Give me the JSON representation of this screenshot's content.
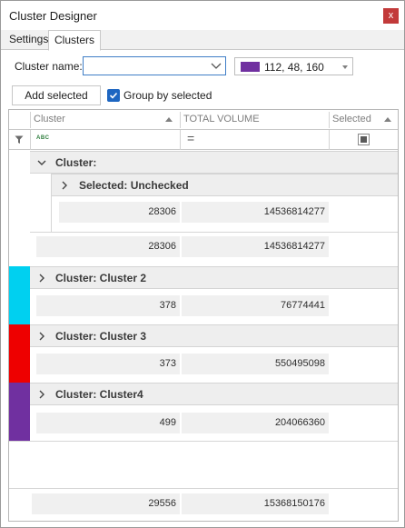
{
  "window": {
    "title": "Cluster Designer",
    "close_glyph": "x"
  },
  "tabs": [
    {
      "label": "Settings"
    },
    {
      "label": "Clusters",
      "active": true
    }
  ],
  "form": {
    "cluster_name_label": "Cluster name:",
    "cluster_name_value": "",
    "color_text": "112, 48, 160",
    "color_hex": "#7030a0",
    "add_selected_label": "Add selected",
    "group_by_label": "Group by selected",
    "group_by_checked": true
  },
  "grid": {
    "columns": [
      {
        "label": "Cluster"
      },
      {
        "label": "TOTAL VOLUME"
      },
      {
        "label": "Selected"
      }
    ],
    "filter_text_glyph": "ABC",
    "filter_number_glyph": "=",
    "groups": [
      {
        "label": "Cluster:",
        "color": "",
        "subgroup": {
          "label": "Selected: Unchecked",
          "count": "28306",
          "volume": "14536814277"
        },
        "count": "28306",
        "volume": "14536814277"
      },
      {
        "label": "Cluster: Cluster 2",
        "color": "#00d0f0",
        "count": "378",
        "volume": "76774441"
      },
      {
        "label": "Cluster: Cluster 3",
        "color": "#ee0000",
        "count": "373",
        "volume": "550495098"
      },
      {
        "label": "Cluster: Cluster4",
        "color": "#7030a0",
        "count": "499",
        "volume": "204066360"
      }
    ],
    "footer": {
      "count": "29556",
      "volume": "15368150176"
    }
  }
}
